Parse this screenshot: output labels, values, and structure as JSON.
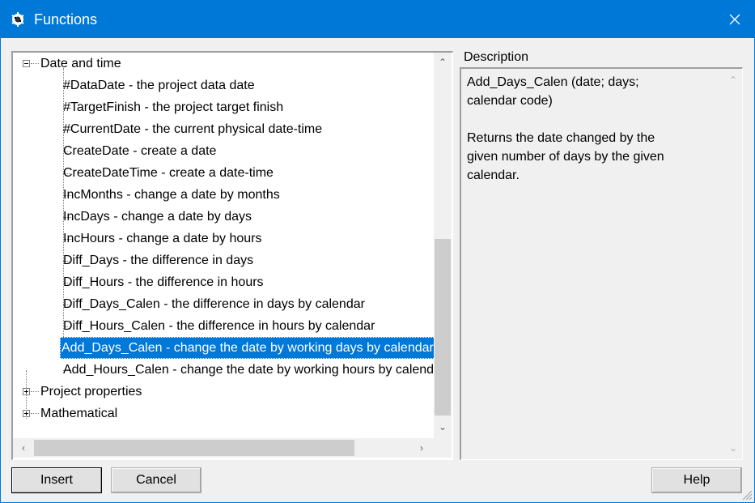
{
  "window": {
    "title": "Functions",
    "app_icon": "cpm-gear-icon",
    "close_icon": "close-icon"
  },
  "tree": {
    "groups": [
      {
        "label": "Date and time",
        "expanded": true,
        "items": [
          "#DataDate - the project data date",
          "#TargetFinish - the project target finish",
          "#CurrentDate - the current physical date-time",
          "CreateDate - create a date",
          "CreateDateTime - create a date-time",
          "IncMonths - change a date by months",
          "IncDays - change a date by days",
          "IncHours - change a date by hours",
          "Diff_Days - the difference in days",
          "Diff_Hours - the difference in hours",
          "Diff_Days_Calen - the difference in days by calendar",
          "Diff_Hours_Calen - the difference in hours by calendar",
          "Add_Days_Calen - change the date by working days by calendar",
          "Add_Hours_Calen - change the date by working hours by calendar"
        ]
      },
      {
        "label": "Project properties",
        "expanded": false
      },
      {
        "label": "Mathematical",
        "expanded": false
      }
    ],
    "selected_item": "Add_Days_Calen - change the date by working days by calendar"
  },
  "description": {
    "heading": "Description",
    "text": "Add_Days_Calen (date; days;\ncalendar code)\n\nReturns the date changed by the\ngiven number of days by the given\ncalendar."
  },
  "buttons": {
    "insert": "Insert",
    "cancel": "Cancel",
    "help": "Help"
  },
  "colors": {
    "titlebar": "#0078d7",
    "selection": "#0078d7"
  }
}
